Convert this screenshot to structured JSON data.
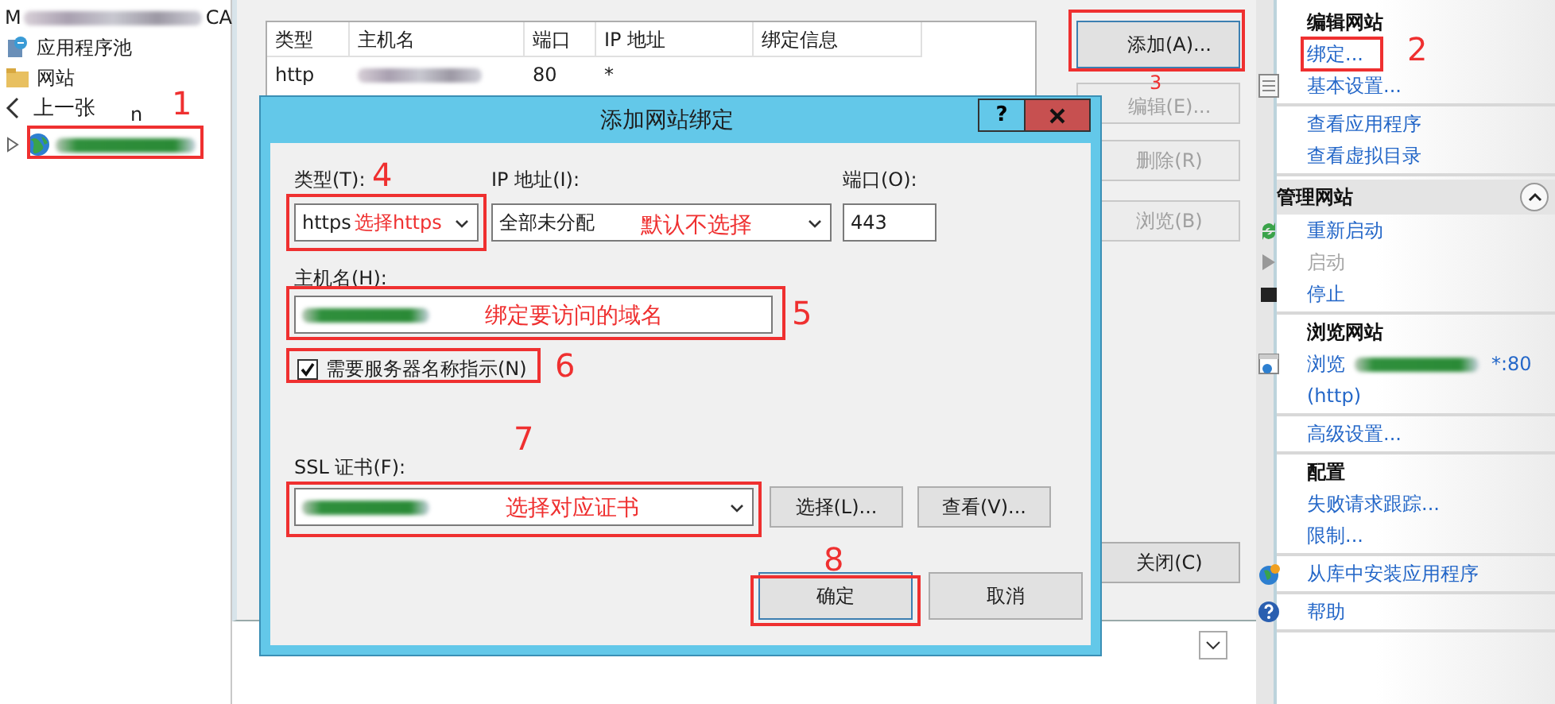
{
  "navigation_tree": {
    "header_fragments": [
      "M",
      "CA"
    ],
    "items": [
      {
        "label": "应用程序池"
      },
      {
        "label": "网站"
      }
    ],
    "site_node": {
      "expanded": false
    }
  },
  "image_viewer_overlay": {
    "previous_label": "上一张",
    "stray_text": "n"
  },
  "site_bindings": {
    "columns": [
      "类型",
      "主机名",
      "端口",
      "IP 地址",
      "绑定信息"
    ],
    "rows": [
      {
        "type": "http",
        "port": "80",
        "ip_address": "*"
      }
    ],
    "buttons": [
      {
        "label": "添加(A)...",
        "disabled": false
      },
      {
        "label": "编辑(E)...",
        "disabled": true
      },
      {
        "label": "删除(R)",
        "disabled": true
      },
      {
        "label": "浏览(B)",
        "disabled": true
      }
    ],
    "close_button": "关闭(C)"
  },
  "add_binding_dialog": {
    "title": "添加网站绑定",
    "help_button": "?",
    "type": {
      "label": "类型(T):",
      "value": "https"
    },
    "ip_address": {
      "label": "IP 地址(I):",
      "value": "全部未分配"
    },
    "port": {
      "label": "端口(O):",
      "value": "443"
    },
    "host_name": {
      "label": "主机名(H):"
    },
    "sni": {
      "label": "需要服务器名称指示(N)",
      "checked": true
    },
    "ssl_certificate": {
      "label": "SSL 证书(F):"
    },
    "select_button": "选择(L)...",
    "view_button": "查看(V)...",
    "ok_button": "确定",
    "cancel_button": "取消"
  },
  "actions_pane": {
    "sections": [
      {
        "title": "编辑网站",
        "items": [
          {
            "label": "绑定...",
            "disabled": false
          },
          {
            "label": "基本设置...",
            "disabled": false
          }
        ]
      },
      {
        "items": [
          {
            "label": "查看应用程序",
            "disabled": false
          },
          {
            "label": "查看虚拟目录",
            "disabled": false
          }
        ]
      },
      {
        "title": "管理网站",
        "expanded": true,
        "items": [
          {
            "label": "重新启动",
            "disabled": false
          },
          {
            "label": "启动",
            "disabled": true
          },
          {
            "label": "停止",
            "disabled": false
          }
        ]
      },
      {
        "title": "浏览网站",
        "items": [
          {
            "label": "浏览",
            "suffix": "*:80",
            "detail": "(http)",
            "disabled": false
          }
        ]
      },
      {
        "items": [
          {
            "label": "高级设置...",
            "disabled": false
          }
        ]
      },
      {
        "title": "配置",
        "items": [
          {
            "label": "失败请求跟踪...",
            "disabled": false
          },
          {
            "label": "限制...",
            "disabled": false
          }
        ]
      },
      {
        "items": [
          {
            "label": "从库中安装应用程序",
            "disabled": false
          }
        ]
      },
      {
        "items": [
          {
            "label": "帮助",
            "disabled": false
          }
        ]
      }
    ]
  },
  "annotations": [
    {
      "kind": "number",
      "text": "1"
    },
    {
      "kind": "number",
      "text": "2"
    },
    {
      "kind": "number",
      "text": "3"
    },
    {
      "kind": "number",
      "text": "4"
    },
    {
      "kind": "note",
      "text": "选择https"
    },
    {
      "kind": "note",
      "text": "默认不选择"
    },
    {
      "kind": "number",
      "text": "5"
    },
    {
      "kind": "note",
      "text": "绑定要访问的域名"
    },
    {
      "kind": "number",
      "text": "6"
    },
    {
      "kind": "number",
      "text": "7"
    },
    {
      "kind": "note",
      "text": "选择对应证书"
    },
    {
      "kind": "number",
      "text": "8"
    }
  ]
}
